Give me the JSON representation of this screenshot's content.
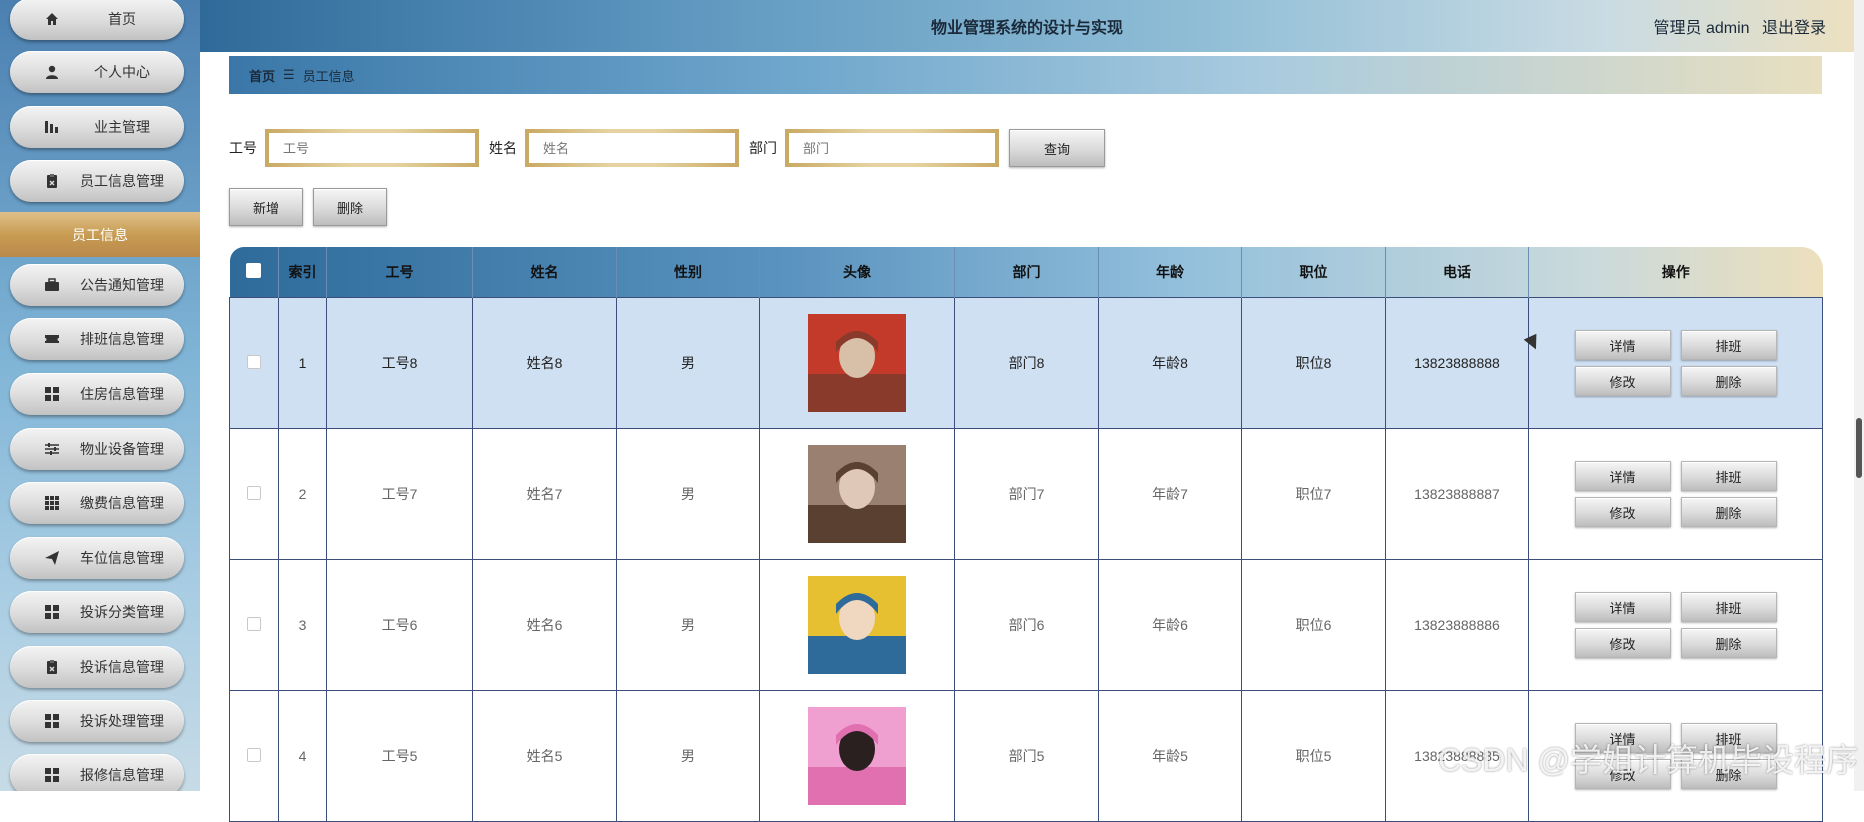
{
  "header": {
    "title": "物业管理系统的设计与实现",
    "user_label": "管理员 admin",
    "logout": "退出登录"
  },
  "sidebar": {
    "items": [
      {
        "label": "首页",
        "icon": "home-icon"
      },
      {
        "label": "个人中心",
        "icon": "user-icon"
      },
      {
        "label": "业主管理",
        "icon": "chart-bars-icon"
      },
      {
        "label": "员工信息管理",
        "icon": "clipboard-icon"
      },
      {
        "label": "公告通知管理",
        "icon": "briefcase-icon"
      },
      {
        "label": "排班信息管理",
        "icon": "ticket-icon"
      },
      {
        "label": "住房信息管理",
        "icon": "grid-icon"
      },
      {
        "label": "物业设备管理",
        "icon": "sliders-icon"
      },
      {
        "label": "缴费信息管理",
        "icon": "apps-icon"
      },
      {
        "label": "车位信息管理",
        "icon": "send-icon"
      },
      {
        "label": "投诉分类管理",
        "icon": "grid-icon"
      },
      {
        "label": "投诉信息管理",
        "icon": "clipboard-icon"
      },
      {
        "label": "投诉处理管理",
        "icon": "grid-icon"
      },
      {
        "label": "报修信息管理",
        "icon": "grid-icon"
      }
    ],
    "active_sub": "员工信息"
  },
  "breadcrumb": {
    "home": "首页",
    "sep": "☰",
    "current": "员工信息"
  },
  "search": {
    "fields": [
      {
        "label": "工号",
        "placeholder": "工号"
      },
      {
        "label": "姓名",
        "placeholder": "姓名"
      },
      {
        "label": "部门",
        "placeholder": "部门"
      }
    ],
    "button": "查询"
  },
  "actions": {
    "add": "新增",
    "delete": "删除"
  },
  "table": {
    "headers": [
      "索引",
      "工号",
      "姓名",
      "性别",
      "头像",
      "部门",
      "年龄",
      "职位",
      "电话",
      "操作"
    ],
    "rows": [
      {
        "index": "1",
        "id": "工号8",
        "name": "姓名8",
        "gender": "男",
        "dept": "部门8",
        "age": "年龄8",
        "position": "职位8",
        "phone": "13823888888",
        "avatar_colors": [
          "#8a3a2a",
          "#c43a2a",
          "#d8c0a8"
        ]
      },
      {
        "index": "2",
        "id": "工号7",
        "name": "姓名7",
        "gender": "男",
        "dept": "部门7",
        "age": "年龄7",
        "position": "职位7",
        "phone": "13823888887",
        "avatar_colors": [
          "#5a4030",
          "#9a8070",
          "#e0c8b8"
        ]
      },
      {
        "index": "3",
        "id": "工号6",
        "name": "姓名6",
        "gender": "男",
        "dept": "部门6",
        "age": "年龄6",
        "position": "职位6",
        "phone": "13823888886",
        "avatar_colors": [
          "#2e6a9a",
          "#e6c030",
          "#f0d8c0"
        ]
      },
      {
        "index": "4",
        "id": "工号5",
        "name": "姓名5",
        "gender": "男",
        "dept": "部门5",
        "age": "年龄5",
        "position": "职位5",
        "phone": "13823888885",
        "avatar_colors": [
          "#e070b0",
          "#f0a0d0",
          "#2a2020"
        ]
      }
    ],
    "ops": {
      "detail": "详情",
      "schedule": "排班",
      "edit": "修改",
      "remove": "删除"
    }
  },
  "watermark": "CSDN @学姐计算机毕设程序"
}
